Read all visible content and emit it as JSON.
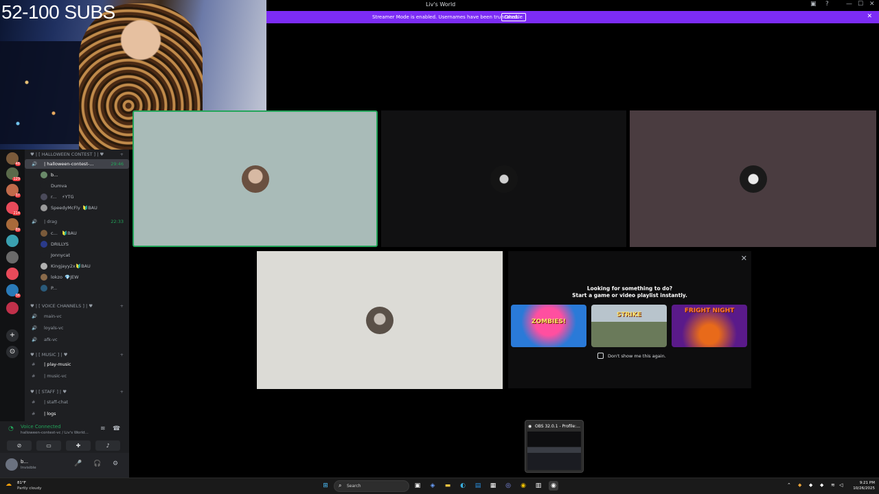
{
  "window": {
    "title": "Liv's World",
    "minimize": "—",
    "maximize": "☐",
    "close": "✕"
  },
  "banner": {
    "message": "Streamer Mode is enabled. Usernames have been truncated.",
    "disable_label": "Disable",
    "close": "✕"
  },
  "overlay": {
    "subs_text": "52-100 SUBS"
  },
  "servers": [
    {
      "badge": "48",
      "color": "#7a5a3a"
    },
    {
      "badge": "129",
      "color": "#5a6a4a"
    },
    {
      "badge": "37",
      "color": "#c06a4a"
    },
    {
      "badge": "214",
      "color": "#e84a5a"
    },
    {
      "badge": "89",
      "color": "#a86a3a"
    },
    {
      "badge": "",
      "color": "#3aa0b0"
    },
    {
      "badge": "",
      "color": "#6a6a6a"
    },
    {
      "badge": "",
      "color": "#e84a5a"
    },
    {
      "badge": "36",
      "color": "#2a7ab8"
    },
    {
      "badge": "",
      "color": "#c0304a"
    }
  ],
  "channels": {
    "cat_halloween": "♥ | [ HALLOWEEN CONTEST ] | ♥",
    "halloween_vc": "| halloween-contest-...",
    "halloween_time": "29:46",
    "voice_users": [
      {
        "name": "b...",
        "badge": ""
      },
      {
        "name": "Dumva",
        "badge": ""
      },
      {
        "name": "r...",
        "badge": "⚡YTG"
      },
      {
        "name": "SpeedyMcFly",
        "badge": "🔰BAU"
      }
    ],
    "drag_vc": "| drag",
    "drag_time": "22:33",
    "drag_users": [
      {
        "name": "c...",
        "badge": "🔰BAU"
      },
      {
        "name": "DRILLYS",
        "badge": ""
      },
      {
        "name": "Jonnycat",
        "badge": ""
      },
      {
        "name": "Kingjayy2x",
        "badge": "🔰BAU"
      },
      {
        "name": "lokzo",
        "badge": "💎JEW"
      },
      {
        "name": "P...",
        "badge": ""
      }
    ],
    "cat_voice": "♥ | [ VOICE CHANNELS ] | ♥",
    "voice_channels": [
      "main-vc",
      "loyals-vc",
      "afk-vc"
    ],
    "cat_music": "♥ | [ MUSIC ] | ♥",
    "play_music": "| play-music",
    "music_vc": "| music-vc",
    "cat_staff": "♥ | [ STAFF ] | ♥",
    "staff_chat": "| staff-chat",
    "logs": "| logs"
  },
  "voice_panel": {
    "status": "Voice Connected",
    "channel": "halloween-contest-vc / Liv's World..."
  },
  "user": {
    "name": "b...",
    "status": "Invisible"
  },
  "activity": {
    "heading": "Looking for something to do?",
    "subheading": "Start a game or video playlist instantly.",
    "games": [
      "ZOMBIES!",
      "STRIKE",
      "FRIGHT NIGHT"
    ],
    "checkbox_label": "Don't show me this again."
  },
  "obs": {
    "title": "OBS 32.0.1 - Profile:..."
  },
  "taskbar": {
    "weather_temp": "81°F",
    "weather_desc": "Partly cloudy",
    "search_placeholder": "Search",
    "time": "9:21 PM",
    "date": "10/26/2025"
  },
  "colors": {
    "accent": "#7c2cf5",
    "voice_green": "#23a55a"
  }
}
